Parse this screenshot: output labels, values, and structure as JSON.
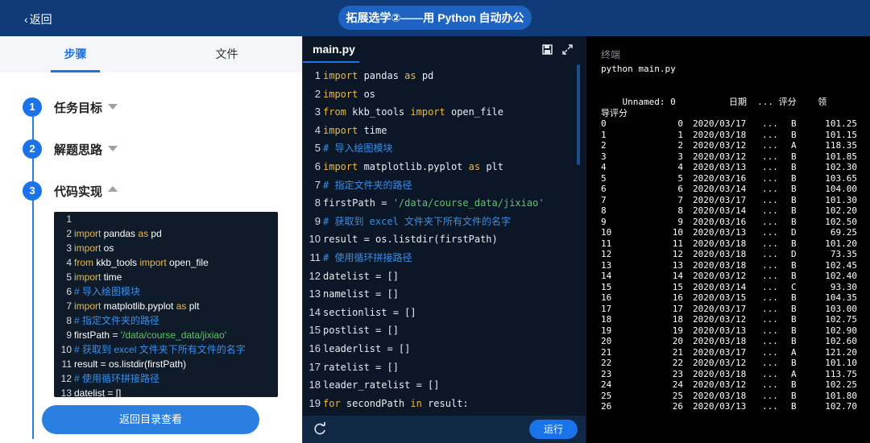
{
  "topbar": {
    "back_label": "返回",
    "title": "拓展选学②——用 Python 自动办公"
  },
  "left_panel": {
    "tabs": [
      {
        "label": "步骤",
        "active": true
      },
      {
        "label": "文件",
        "active": false
      }
    ],
    "steps": [
      {
        "number": "1",
        "label": "任务目标",
        "state": "collapsed"
      },
      {
        "number": "2",
        "label": "解题思路",
        "state": "collapsed"
      },
      {
        "number": "3",
        "label": "代码实现",
        "state": "expanded"
      }
    ],
    "snippet_lines": [
      {
        "n": "1",
        "text": ""
      },
      {
        "n": "2",
        "text": "import pandas as pd"
      },
      {
        "n": "3",
        "text": "import os"
      },
      {
        "n": "4",
        "text": "from kkb_tools import open_file"
      },
      {
        "n": "5",
        "text": "import time"
      },
      {
        "n": "6",
        "text": "# 导入绘图模块"
      },
      {
        "n": "7",
        "text": "import matplotlib.pyplot as plt"
      },
      {
        "n": "8",
        "text": "# 指定文件夹的路径"
      },
      {
        "n": "9",
        "text": "firstPath = '/data/course_data/jixiao'"
      },
      {
        "n": "10",
        "text": "# 获取到 excel 文件夹下所有文件的名字"
      },
      {
        "n": "11",
        "text": "result = os.listdir(firstPath)"
      },
      {
        "n": "12",
        "text": "# 使用循环拼接路径"
      },
      {
        "n": "13",
        "text": "datelist = []"
      }
    ],
    "back_to_list_label": "返回目录查看"
  },
  "editor": {
    "filename": "main.py",
    "run_label": "运行",
    "lines": [
      {
        "n": "1",
        "text": "import pandas as pd"
      },
      {
        "n": "2",
        "text": "import os"
      },
      {
        "n": "3",
        "text": "from kkb_tools import open_file"
      },
      {
        "n": "4",
        "text": "import time"
      },
      {
        "n": "5",
        "text": "# 导入绘图模块"
      },
      {
        "n": "6",
        "text": "import matplotlib.pyplot as plt"
      },
      {
        "n": "7",
        "text": "# 指定文件夹的路径"
      },
      {
        "n": "8",
        "text": "firstPath = '/data/course_data/jixiao'"
      },
      {
        "n": "9",
        "text": "# 获取到 excel 文件夹下所有文件的名字"
      },
      {
        "n": "10",
        "text": "result = os.listdir(firstPath)"
      },
      {
        "n": "11",
        "text": "# 使用循环拼接路径"
      },
      {
        "n": "12",
        "text": "datelist = []"
      },
      {
        "n": "13",
        "text": "namelist = []"
      },
      {
        "n": "14",
        "text": "sectionlist = []"
      },
      {
        "n": "15",
        "text": "postlist = []"
      },
      {
        "n": "16",
        "text": "leaderlist = []"
      },
      {
        "n": "17",
        "text": "ratelist = []"
      },
      {
        "n": "18",
        "text": "leader_ratelist = []"
      },
      {
        "n": "19",
        "text": "for secondPath in result:"
      }
    ]
  },
  "terminal": {
    "title": "终端",
    "command": "python main.py",
    "header_line1": "    Unnamed: 0          日期  ... 评分    领",
    "header_line2": "导评分",
    "rows": [
      [
        "0",
        "0",
        "2020/03/17",
        "...",
        "B",
        "101.25"
      ],
      [
        "1",
        "1",
        "2020/03/18",
        "...",
        "B",
        "101.15"
      ],
      [
        "2",
        "2",
        "2020/03/12",
        "...",
        "A",
        "118.35"
      ],
      [
        "3",
        "3",
        "2020/03/12",
        "...",
        "B",
        "101.85"
      ],
      [
        "4",
        "4",
        "2020/03/13",
        "...",
        "B",
        "102.30"
      ],
      [
        "5",
        "5",
        "2020/03/16",
        "...",
        "B",
        "103.65"
      ],
      [
        "6",
        "6",
        "2020/03/14",
        "...",
        "B",
        "104.00"
      ],
      [
        "7",
        "7",
        "2020/03/17",
        "...",
        "B",
        "101.30"
      ],
      [
        "8",
        "8",
        "2020/03/14",
        "...",
        "B",
        "102.20"
      ],
      [
        "9",
        "9",
        "2020/03/16",
        "...",
        "B",
        "102.50"
      ],
      [
        "10",
        "10",
        "2020/03/13",
        "...",
        "D",
        "69.25"
      ],
      [
        "11",
        "11",
        "2020/03/18",
        "...",
        "B",
        "101.20"
      ],
      [
        "12",
        "12",
        "2020/03/18",
        "...",
        "D",
        "73.35"
      ],
      [
        "13",
        "13",
        "2020/03/18",
        "...",
        "B",
        "102.45"
      ],
      [
        "14",
        "14",
        "2020/03/12",
        "...",
        "B",
        "102.40"
      ],
      [
        "15",
        "15",
        "2020/03/14",
        "...",
        "C",
        "93.30"
      ],
      [
        "16",
        "16",
        "2020/03/15",
        "...",
        "B",
        "104.35"
      ],
      [
        "17",
        "17",
        "2020/03/17",
        "...",
        "B",
        "103.00"
      ],
      [
        "18",
        "18",
        "2020/03/12",
        "...",
        "B",
        "102.75"
      ],
      [
        "19",
        "19",
        "2020/03/13",
        "...",
        "B",
        "102.90"
      ],
      [
        "20",
        "20",
        "2020/03/18",
        "...",
        "B",
        "102.60"
      ],
      [
        "21",
        "21",
        "2020/03/17",
        "...",
        "A",
        "121.20"
      ],
      [
        "22",
        "22",
        "2020/03/12",
        "...",
        "B",
        "101.10"
      ],
      [
        "23",
        "23",
        "2020/03/18",
        "...",
        "A",
        "113.75"
      ],
      [
        "24",
        "24",
        "2020/03/12",
        "...",
        "B",
        "102.25"
      ],
      [
        "25",
        "25",
        "2020/03/18",
        "...",
        "B",
        "101.80"
      ],
      [
        "26",
        "26",
        "2020/03/13",
        "...",
        "B",
        "102.70"
      ]
    ]
  }
}
